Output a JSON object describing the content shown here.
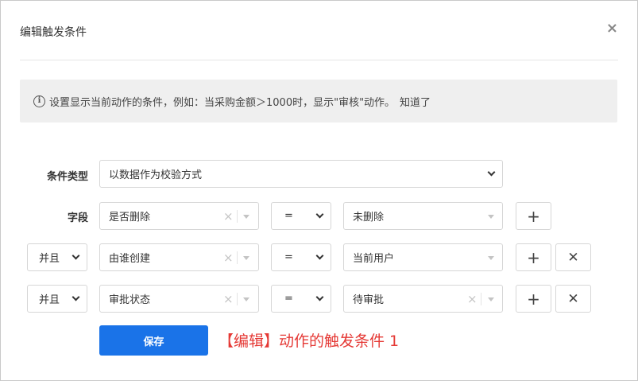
{
  "dialog": {
    "title": "编辑触发条件",
    "close_icon": "close-icon"
  },
  "notice": {
    "text": "设置显示当前动作的条件，例如：当采购金额＞1000时，显示\"审核\"动作。",
    "link": "知道了",
    "icon": "info-icon"
  },
  "condition_type": {
    "label": "条件类型",
    "value": "以数据作为校验方式"
  },
  "field_label": "字段",
  "rows": [
    {
      "field": "是否删除",
      "operator": "=",
      "value": "未删除",
      "add": "+",
      "remove": ""
    },
    {
      "logic": "并且",
      "field": "由谁创建",
      "operator": "=",
      "value": "当前用户",
      "add": "+",
      "remove": "✕"
    },
    {
      "logic": "并且",
      "field": "审批状态",
      "operator": "=",
      "value": "待审批",
      "add": "+",
      "remove": "✕"
    }
  ],
  "save_label": "保存",
  "annotation": "【编辑】动作的触发条件 1",
  "colors": {
    "primary": "#1a73e8",
    "annotation": "#e53935",
    "notice_bg": "#efefef"
  }
}
